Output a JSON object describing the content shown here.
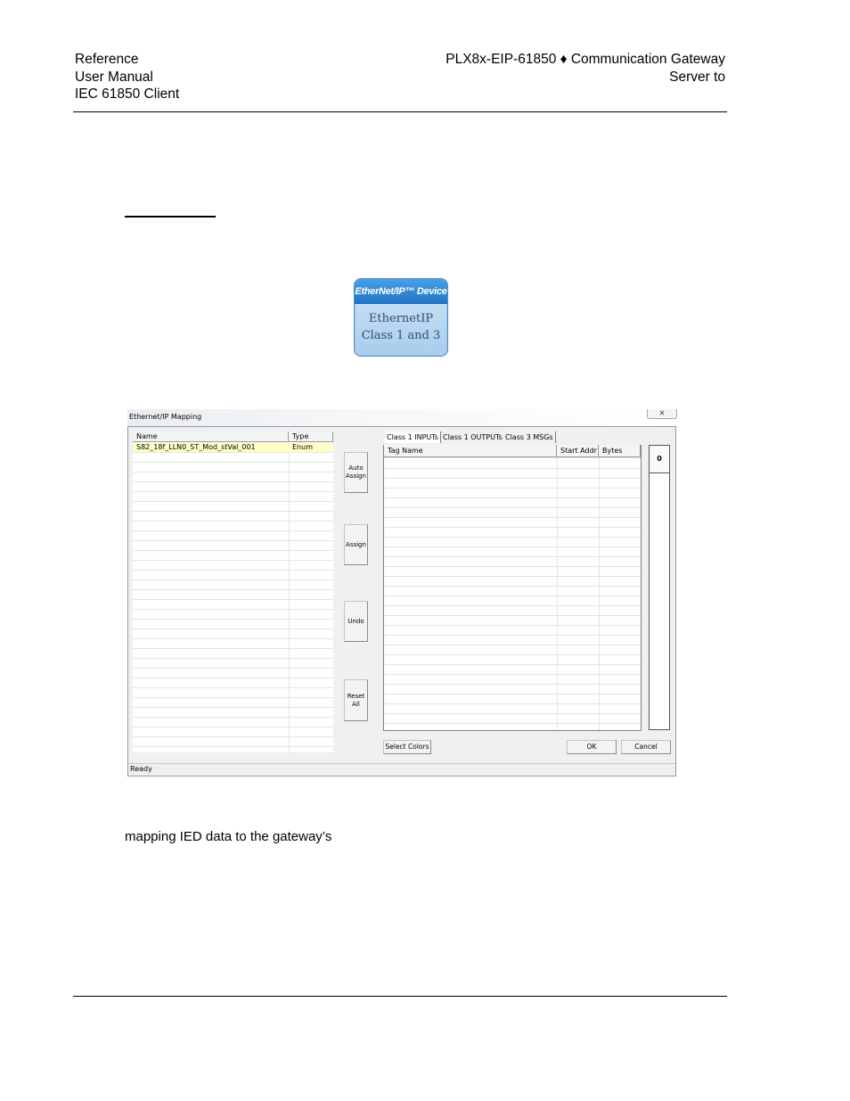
{
  "header": {
    "left": [
      "Reference",
      "User Manual",
      "IEC 61850 Client"
    ],
    "right": [
      "PLX8x-EIP-61850 ♦ Communication Gateway",
      "Server to"
    ]
  },
  "device_icon": {
    "banner": "EtherNet/IP™ Device",
    "line1": "EthernetIP",
    "line2": "Class 1 and 3",
    "colors": {
      "banner": "#1f72c4",
      "body": "#b9d8f2"
    }
  },
  "dialog": {
    "title": "Ethernet/IP Mapping",
    "close_glyph": "✕",
    "left_table": {
      "headers": [
        "Name",
        "Type"
      ],
      "rows": [
        {
          "name": "S82_18f_LLN0_ST_Mod_stVal_001",
          "type": "Enum"
        }
      ]
    },
    "buttons": {
      "auto_assign": "Auto Assign",
      "assign": "Assign",
      "undo": "Undo",
      "reset_all": "Reset All"
    },
    "tabs": [
      "Class 1 INPUTs",
      "Class 1 OUTPUTs",
      "Class 3 MSGs"
    ],
    "right_table": {
      "headers": [
        "Tag Name",
        "Start Addr",
        "Bytes"
      ]
    },
    "scroll_value": "0",
    "select_colors": "Select Colors",
    "ok": "OK",
    "cancel": "Cancel",
    "status": "Ready"
  },
  "body_text": "mapping IED data to the gateway’s"
}
